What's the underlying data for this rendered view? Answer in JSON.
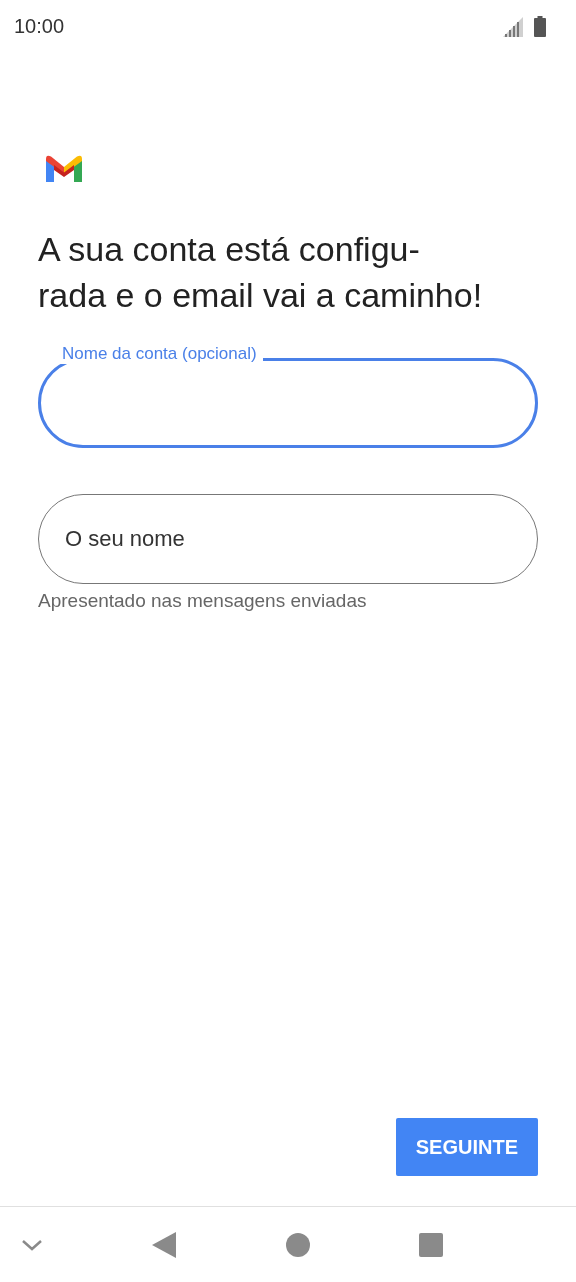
{
  "status_bar": {
    "time": "10:00"
  },
  "heading_lines": [
    "A sua conta está configu-",
    "rada e o email vai a caminho!"
  ],
  "fields": [
    {
      "label": "Nome da conta (opcional)",
      "focused": true
    },
    {
      "placeholder": "O seu nome",
      "focused": false,
      "helper": "Apresentado nas mensagens enviadas"
    }
  ],
  "next_button": "SEGUINTE"
}
